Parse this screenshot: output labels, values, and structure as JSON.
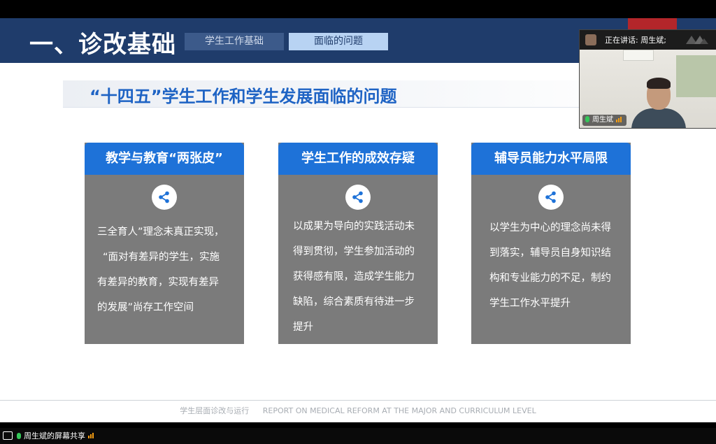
{
  "slide": {
    "section_title": "一、诊改基础",
    "nav_tabs": [
      {
        "label": "学生工作基础",
        "active": false
      },
      {
        "label": "面临的问题",
        "active": true
      }
    ],
    "topic_title": "“十四五”学生工作和学生发展面临的问题",
    "cards": [
      {
        "title": "教学与教育“两张皮”",
        "icon": "share-icon",
        "lines": [
          "三全育人”理念未真正实现，",
          "“面对有差异的学生，实施",
          "有差异的教育，实现有差异",
          "的发展”尚存工作空间"
        ]
      },
      {
        "title": "学生工作的成效存疑",
        "icon": "share-icon",
        "lines": [
          "以成果为导向的实践活动未",
          "得到贯彻，学生参加活动的",
          "获得感有限，造成学生能力",
          "缺陷，综合素质有待进一步",
          "提升"
        ]
      },
      {
        "title": "辅导员能力水平局限",
        "icon": "share-icon",
        "lines": [
          "以学生为中心的理念尚未得",
          "到落实，辅导员自身知识结",
          "构和专业能力的不足，制约",
          "学生工作水平提升"
        ]
      }
    ],
    "footer": {
      "cn": "学生层面诊改与运行",
      "en": "REPORT ON MEDICAL REFORM AT THE MAJOR AND CURRICULUM LEVEL"
    }
  },
  "meeting": {
    "speaking_label": "正在讲话: 周生斌;",
    "participant_name": "周生斌",
    "share_status": "周生斌的屏幕共享"
  },
  "colors": {
    "header_navy": "#1f3c6b",
    "card_header_blue": "#1e72d8",
    "card_body_gray": "#7b7b7b",
    "topic_blue": "#1e63c4"
  }
}
